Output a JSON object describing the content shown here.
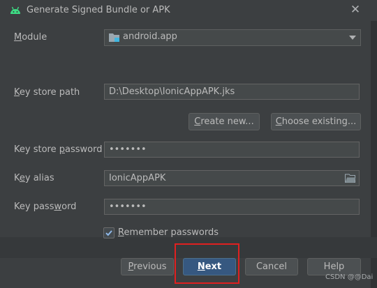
{
  "window": {
    "title": "Generate Signed Bundle or APK",
    "close_glyph": "✕"
  },
  "module": {
    "label_mnemonic": "M",
    "label_rest": "odule",
    "value": "android.app"
  },
  "key_store_path": {
    "label_mnemonic": "K",
    "label_rest": "ey store path",
    "value": "D:\\Desktop\\IonicAppAPK.jks"
  },
  "buttons": {
    "create_new_mn": "C",
    "create_new_rest": "reate new...",
    "choose_existing_mn": "C",
    "choose_existing_rest": "hoose existing...",
    "previous_mn": "P",
    "previous_rest": "revious",
    "next_mn": "N",
    "next_rest": "ext",
    "cancel": "Cancel",
    "help": "Help"
  },
  "key_store_password": {
    "label_start": "Key store ",
    "label_mnemonic": "p",
    "label_rest": "assword",
    "value": "•••••••"
  },
  "key_alias": {
    "label_start": "K",
    "label_mnemonic": "e",
    "label_rest": "y alias",
    "value": "IonicAppAPK"
  },
  "key_password": {
    "label_start": "Key pass",
    "label_mnemonic": "w",
    "label_rest": "ord",
    "value": "•••••••"
  },
  "remember": {
    "label_mnemonic": "R",
    "label_rest": "emember passwords",
    "checked": true
  },
  "watermark": "CSDN @@Dai",
  "colors": {
    "background": "#3c3f41",
    "field": "#45494a",
    "primary_button": "#365880",
    "highlight": "#e02020"
  }
}
